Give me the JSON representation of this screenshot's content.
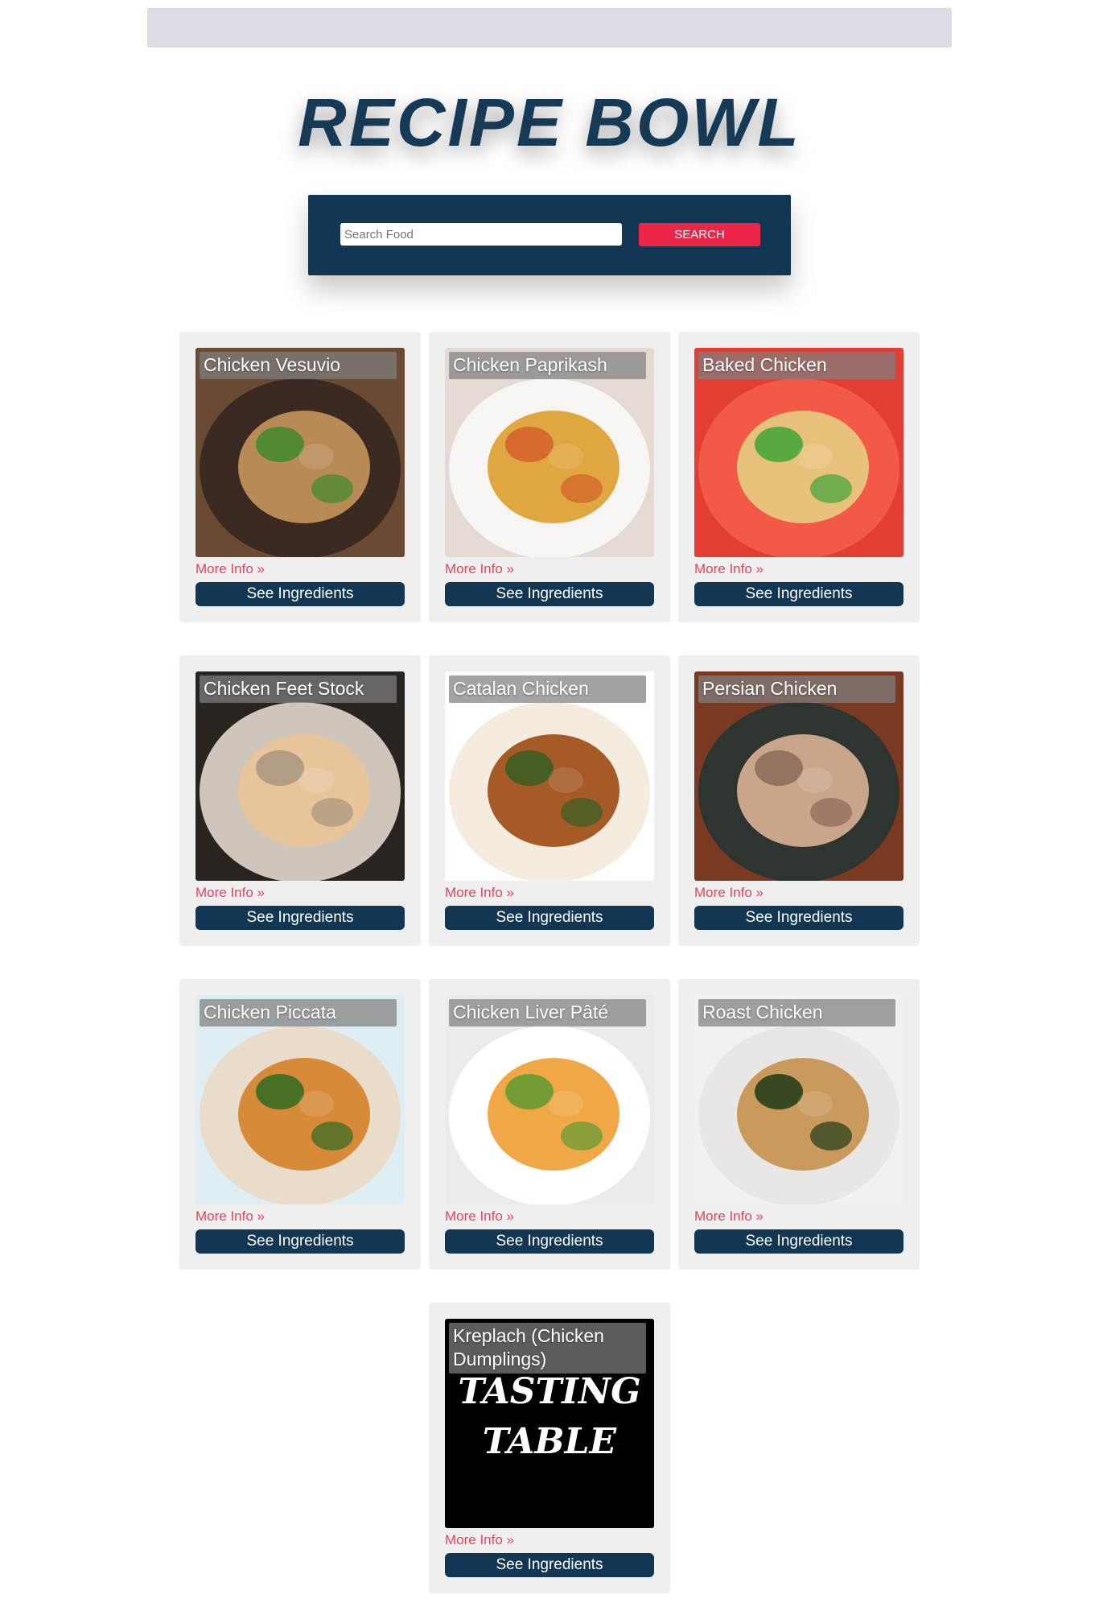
{
  "brand": {
    "title": "RECIPE BOWL"
  },
  "search": {
    "placeholder": "Search Food",
    "value": "",
    "button_label": "SEARCH"
  },
  "recipes": [
    {
      "title": "Chicken Vesuvio",
      "more_info": "More Info »",
      "ingredients_label": "See Ingredients",
      "image_icon": "chicken-vesuvio-photo",
      "colors": {
        "bg": "#6b4a34",
        "plate": "#3a2a22",
        "food": "#b88a55",
        "accent": "#3f8a2f"
      }
    },
    {
      "title": "Chicken Paprikash",
      "more_info": "More Info »",
      "ingredients_label": "See Ingredients",
      "image_icon": "chicken-paprikash-photo",
      "colors": {
        "bg": "#e4d9d3",
        "plate": "#f7f5f1",
        "food": "#e0a640",
        "accent": "#d3602a"
      }
    },
    {
      "title": "Baked Chicken",
      "more_info": "More Info »",
      "ingredients_label": "See Ingredients",
      "image_icon": "baked-chicken-tray-photo",
      "colors": {
        "bg": "#e33e34",
        "plate": "#f25a47",
        "food": "#e8c27a",
        "accent": "#3fa43a"
      }
    },
    {
      "title": "Chicken Feet Stock",
      "more_info": "More Info »",
      "ingredients_label": "See Ingredients",
      "image_icon": "chicken-feet-photo",
      "colors": {
        "bg": "#2a2420",
        "plate": "#cfc6bb",
        "food": "#e8c49b",
        "accent": "#a8957e"
      }
    },
    {
      "title": "Catalan Chicken",
      "more_info": "More Info »",
      "ingredients_label": "See Ingredients",
      "image_icon": "catalan-chicken-photo",
      "colors": {
        "bg": "#ffffff",
        "plate": "#f4ecdf",
        "food": "#a65a26",
        "accent": "#355e25"
      }
    },
    {
      "title": "Persian Chicken",
      "more_info": "More Info »",
      "ingredients_label": "See Ingredients",
      "image_icon": "persian-chicken-photo",
      "colors": {
        "bg": "#7a3a22",
        "plate": "#2e3430",
        "food": "#c9a58a",
        "accent": "#8d6a58"
      }
    },
    {
      "title": "Chicken Piccata",
      "more_info": "More Info »",
      "ingredients_label": "See Ingredients",
      "image_icon": "chicken-piccata-photo",
      "colors": {
        "bg": "#dfeef2",
        "plate": "#e9dccb",
        "food": "#d78a38",
        "accent": "#2f6b22"
      }
    },
    {
      "title": "Chicken Liver Pâté",
      "more_info": "More Info »",
      "ingredients_label": "See Ingredients",
      "image_icon": "chicken-liver-pate-photo",
      "colors": {
        "bg": "#ecebea",
        "plate": "#ffffff",
        "food": "#f0a846",
        "accent": "#5e9a33"
      }
    },
    {
      "title": "Roast Chicken",
      "more_info": "More Info »",
      "ingredients_label": "See Ingredients",
      "image_icon": "roast-chicken-photo",
      "colors": {
        "bg": "#f3f1ef",
        "plate": "#e9e7e5",
        "food": "#c99a5c",
        "accent": "#1f3b18"
      }
    },
    {
      "title": "Kreplach (Chicken Dumplings)",
      "more_info": "More Info »",
      "ingredients_label": "See Ingredients",
      "image_icon": "tasting-table-logo",
      "logo_text": [
        "TASTING",
        "TABLE"
      ],
      "colors": {
        "bg": "#000000",
        "plate": "#000000",
        "food": "#ffffff",
        "accent": "#ffffff"
      }
    }
  ]
}
